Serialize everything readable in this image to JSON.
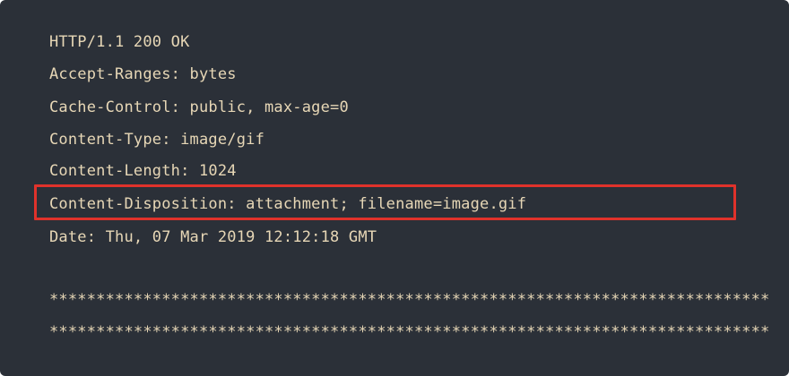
{
  "headers": {
    "status_line": "HTTP/1.1 200 OK",
    "accept_ranges": "Accept-Ranges: bytes",
    "cache_control": "Cache-Control: public, max-age=0",
    "content_type": "Content-Type: image/gif",
    "content_length": "Content-Length: 1024",
    "content_disposition": "Content-Disposition: attachment; filename=image.gif",
    "date": "Date: Thu, 07 Mar 2019 12:12:18 GMT"
  },
  "separator": {
    "line1": "*****************************************************************************",
    "line2": "*****************************************************************************"
  },
  "colors": {
    "background": "#2b3038",
    "text": "#e7d7b6",
    "highlight": "#e0322b"
  }
}
